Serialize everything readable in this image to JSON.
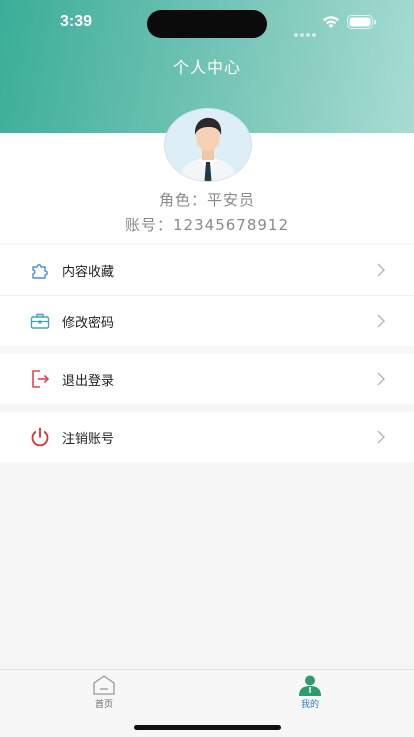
{
  "status_bar": {
    "time": "3:39"
  },
  "header": {
    "title": "个人中心"
  },
  "profile": {
    "role_label": "角色：",
    "role_value": "平安员",
    "account_label": "账号：",
    "account_value": "12345678912"
  },
  "menu": {
    "group1": [
      {
        "label": "内容收藏",
        "icon": "puzzle-icon"
      },
      {
        "label": "修改密码",
        "icon": "toolbox-icon"
      }
    ],
    "group2": [
      {
        "label": "退出登录",
        "icon": "logout-icon"
      }
    ],
    "group3": [
      {
        "label": "注销账号",
        "icon": "power-icon"
      }
    ]
  },
  "tabs": [
    {
      "label": "首页",
      "icon": "home-icon",
      "active": false
    },
    {
      "label": "我的",
      "icon": "person-icon",
      "active": true
    }
  ],
  "colors": {
    "accent_green": "#3aae98",
    "active_tab": "#2f9a6e",
    "inactive_tab": "#9a9a9a",
    "logout_red": "#e0445a",
    "power_red": "#d9342b",
    "icon_blue": "#4a90d9"
  }
}
